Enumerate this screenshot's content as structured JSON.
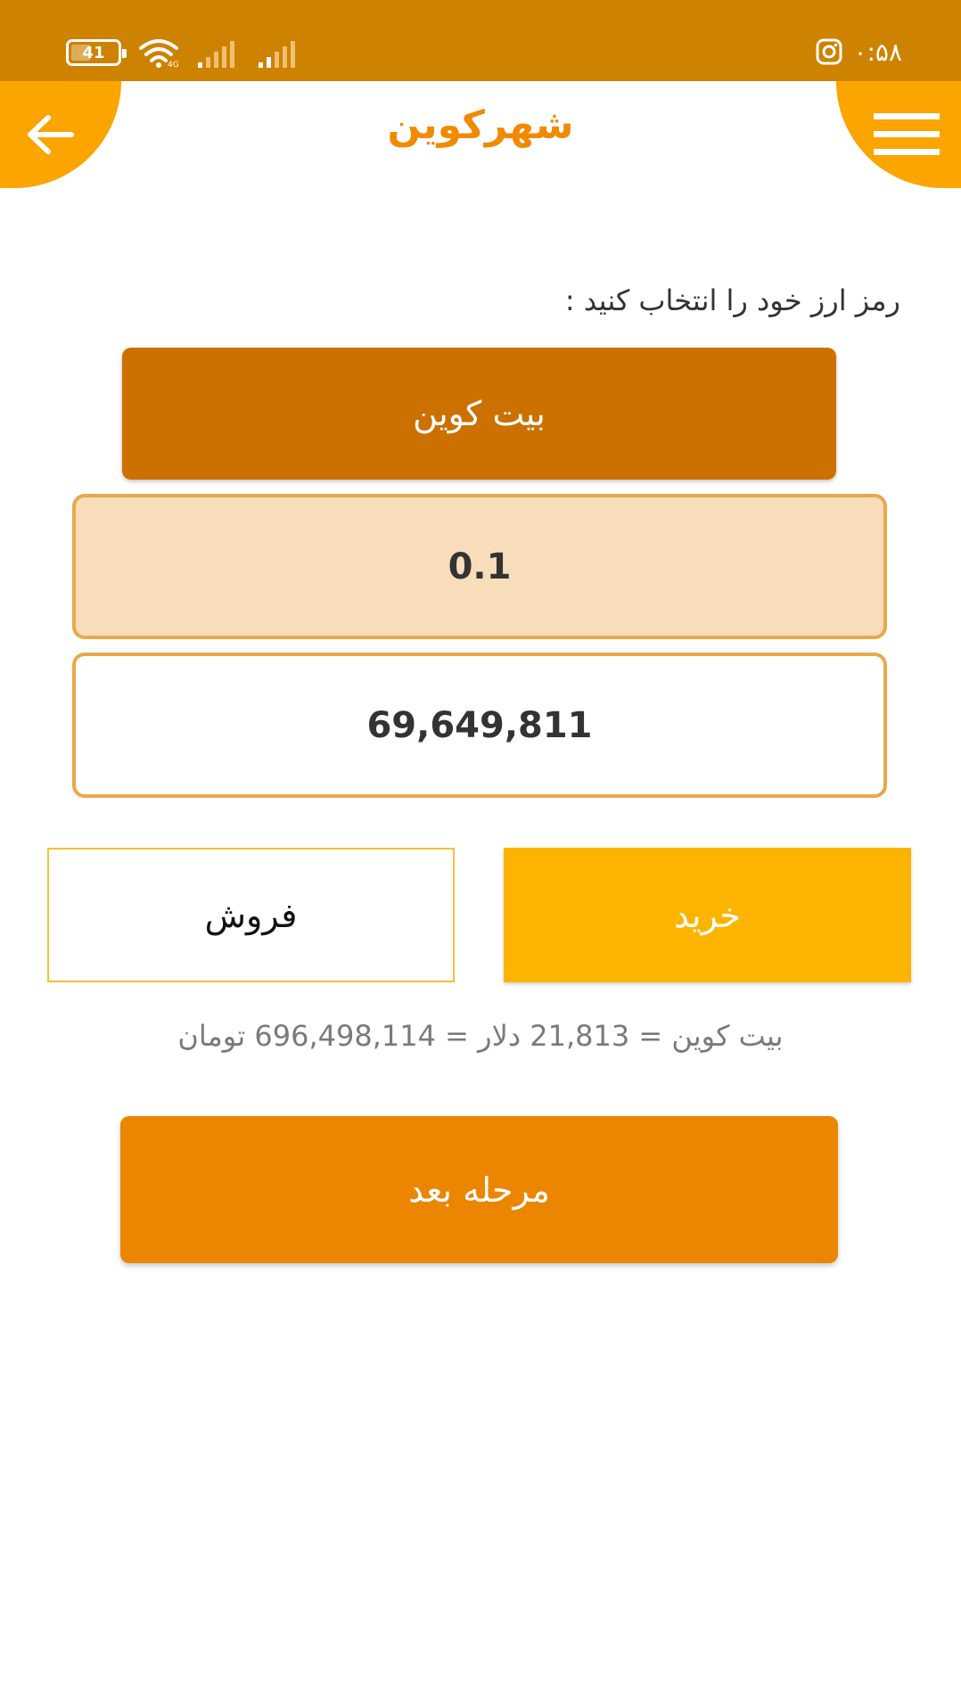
{
  "status_bar": {
    "battery_level": "41",
    "time": "۰:۵۸",
    "icons": [
      "battery-icon",
      "wifi-icon",
      "signal-icon",
      "signal-icon",
      "instagram-icon"
    ]
  },
  "app_bar": {
    "title": "شهرکوین",
    "left_icon": "arrow-left-icon",
    "right_icon": "menu-icon"
  },
  "form": {
    "prompt": "رمز ارز خود را انتخاب کنید :",
    "coin_label": "بیت کوین",
    "amount_value": "0.1",
    "price_value": "69,649,811"
  },
  "actions": {
    "sell_label": "فروش",
    "buy_label": "خرید"
  },
  "rate": {
    "text": "بیت کوین = 21,813 دلار = 696,498,114 تومان"
  },
  "next": {
    "label": "مرحله بعد"
  },
  "colors": {
    "status_bar": "#cd8200",
    "accent": "#fca400",
    "title": "#f28a00",
    "coin_button": "#cc7000",
    "amount_bg": "#f8ddbb",
    "field_border": "#e8a84b",
    "buy_button": "#fdb400",
    "next_button": "#ec8500"
  }
}
